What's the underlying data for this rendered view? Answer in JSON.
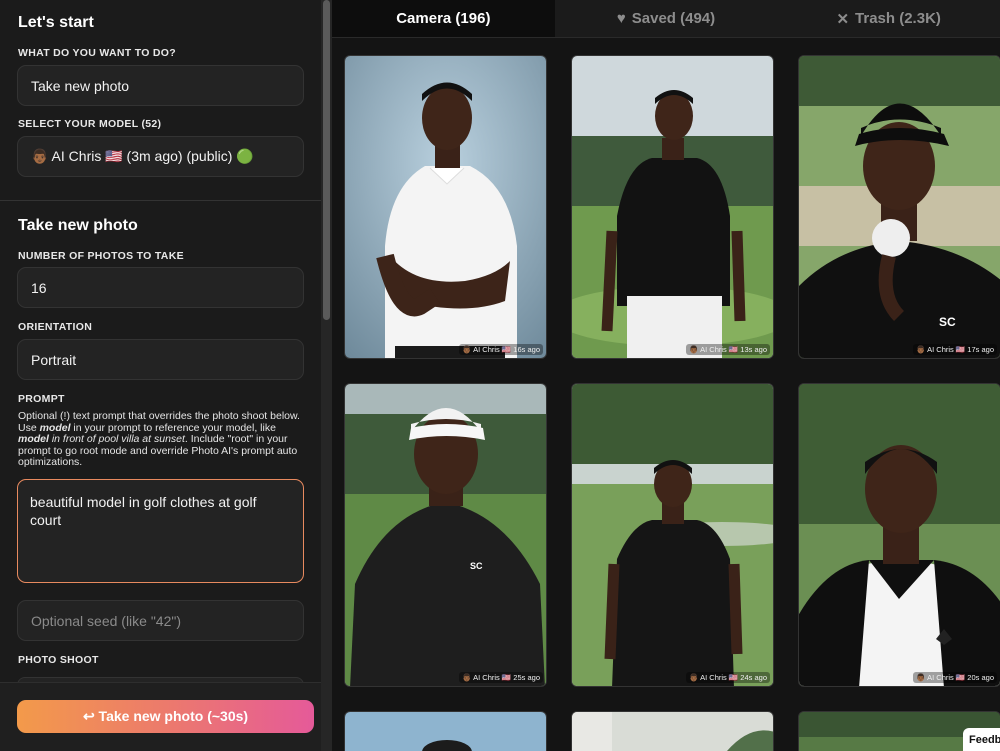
{
  "sidebar": {
    "start_title": "Let's start",
    "what_label": "WHAT DO YOU WANT TO DO?",
    "what_value": "Take new photo",
    "model_label": "SELECT YOUR MODEL (52)",
    "model_value": "👨🏾 AI Chris 🇺🇸 (3m ago) (public) 🟢",
    "take_title": "Take new photo",
    "count_label": "NUMBER OF PHOTOS TO TAKE",
    "count_value": "16",
    "orientation_label": "ORIENTATION",
    "orientation_value": "Portrait",
    "prompt_label": "PROMPT",
    "prompt_help": {
      "p1": "Optional (!) text prompt that overrides the photo shoot below. Use ",
      "model_word": "model",
      "p2": " in your prompt to reference your model, like ",
      "example": "model in front of pool villa at sunset",
      "p3": ". Include \"root\" in your prompt to go root mode and override Photo AI's prompt auto optimizations."
    },
    "prompt_value": "beautiful model in golf clothes at golf court",
    "seed_placeholder": "Optional seed (like \"42\")",
    "shoot_label": "PHOTO SHOOT",
    "take_button": "↩ Take new photo (~30s)"
  },
  "tabs": [
    {
      "label": "Camera (196)",
      "icon": "",
      "active": true
    },
    {
      "label": "Saved (494)",
      "icon": "♥",
      "active": false
    },
    {
      "label": "Trash (2.3K)",
      "icon": "✕",
      "active": false
    }
  ],
  "photos": [
    {
      "caption": "👨🏾 AI Chris 🇺🇸 16s ago",
      "scene": "studio-white-polo"
    },
    {
      "caption": "👨🏾 AI Chris 🇺🇸 13s ago",
      "scene": "golf-black-polo-full"
    },
    {
      "caption": "👨🏾 AI Chris 🇺🇸 17s ago",
      "scene": "golf-cap-ball"
    },
    {
      "caption": "👨🏾 AI Chris 🇺🇸 25s ago",
      "scene": "golf-white-cap"
    },
    {
      "caption": "👨🏾 AI Chris 🇺🇸 24s ago",
      "scene": "golf-black-polo-far"
    },
    {
      "caption": "👨🏾 AI Chris 🇺🇸 20s ago",
      "scene": "golf-black-white-polo"
    }
  ],
  "feedback_label": "Feedb",
  "colors": {
    "accent_start": "#f39a4a",
    "accent_end": "#e55a99",
    "prompt_border": "#e88a5f"
  }
}
